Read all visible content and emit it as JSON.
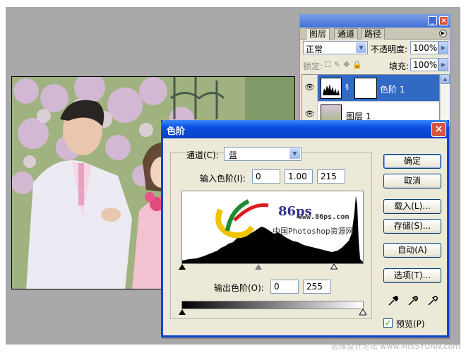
{
  "layers_panel": {
    "tabs": [
      "图层",
      "通道",
      "路径"
    ],
    "blend_mode": "正常",
    "opacity_label": "不透明度:",
    "opacity_value": "100%",
    "lock_label": "锁定:",
    "fill_label": "填充:",
    "fill_value": "100%",
    "layers": [
      {
        "name": "色阶 1",
        "selected": true
      },
      {
        "name": "图层 1",
        "selected": false
      }
    ]
  },
  "levels_dialog": {
    "title": "色阶",
    "channel_label": "通道(C):",
    "channel_value": "蓝",
    "input_levels_label": "输入色阶(I):",
    "input_levels": [
      "0",
      "1.00",
      "215"
    ],
    "output_levels_label": "输出色阶(O):",
    "output_levels": [
      "0",
      "255"
    ],
    "buttons": {
      "ok": "确定",
      "cancel": "取消",
      "load": "载入(L)...",
      "save": "存储(S)...",
      "auto": "自动(A)",
      "options": "选项(T)..."
    },
    "preview_label": "预览(P)",
    "preview_checked": true,
    "histogram_watermark": {
      "number": "86ps",
      "url": "www.86ps.com",
      "cn": "中国Photoshop资源网"
    }
  },
  "watermark": "思缘设计论坛 www.MISSYUAN.com"
}
